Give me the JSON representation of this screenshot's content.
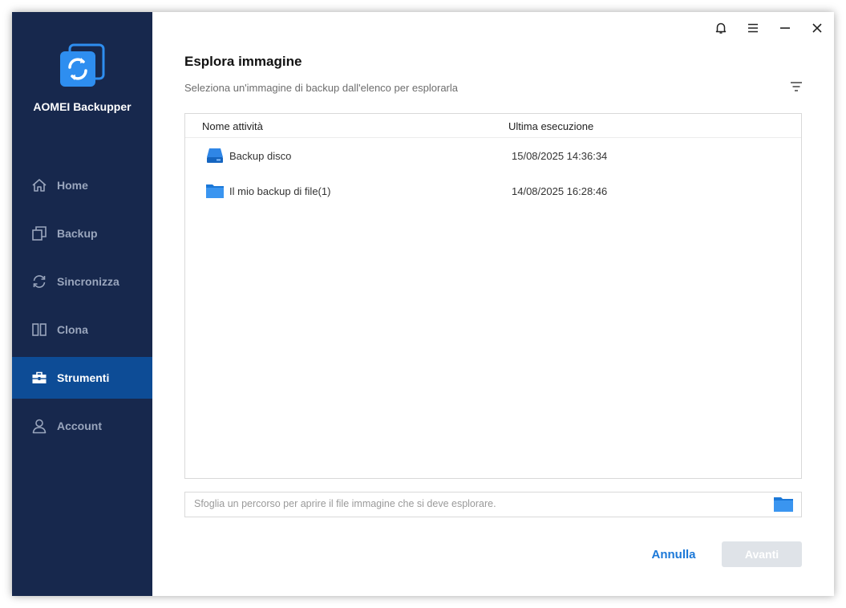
{
  "app": {
    "name": "AOMEI Backupper"
  },
  "sidebar": {
    "items": [
      {
        "label": "Home",
        "icon": "home-icon",
        "active": false
      },
      {
        "label": "Backup",
        "icon": "backup-icon",
        "active": false
      },
      {
        "label": "Sincronizza",
        "icon": "sync-icon",
        "active": false
      },
      {
        "label": "Clona",
        "icon": "clone-icon",
        "active": false
      },
      {
        "label": "Strumenti",
        "icon": "toolbox-icon",
        "active": true
      },
      {
        "label": "Account",
        "icon": "user-icon",
        "active": false
      }
    ]
  },
  "titlebar": {
    "icons": [
      "bell-icon",
      "menu-icon",
      "minimize-icon",
      "close-icon"
    ]
  },
  "main": {
    "title": "Esplora immagine",
    "subtitle": "Seleziona un'immagine di backup dall'elenco per esplorarla",
    "table": {
      "columns": [
        "Nome attività",
        "Ultima esecuzione"
      ],
      "rows": [
        {
          "name": "Backup disco",
          "last_run": "15/08/2025 14:36:34",
          "icon": "disk-icon"
        },
        {
          "name": "Il mio backup di file(1)",
          "last_run": "14/08/2025 16:28:46",
          "icon": "folder-icon"
        }
      ]
    },
    "path_input": {
      "placeholder": "Sfoglia un percorso per aprire il file immagine che si deve esplorare.",
      "value": ""
    },
    "buttons": {
      "cancel": "Annulla",
      "next": "Avanti"
    }
  },
  "colors": {
    "sidebar_bg": "#17284d",
    "sidebar_active": "#0d4c96",
    "accent": "#1b78d8",
    "disabled_button": "#dfe3e8"
  }
}
